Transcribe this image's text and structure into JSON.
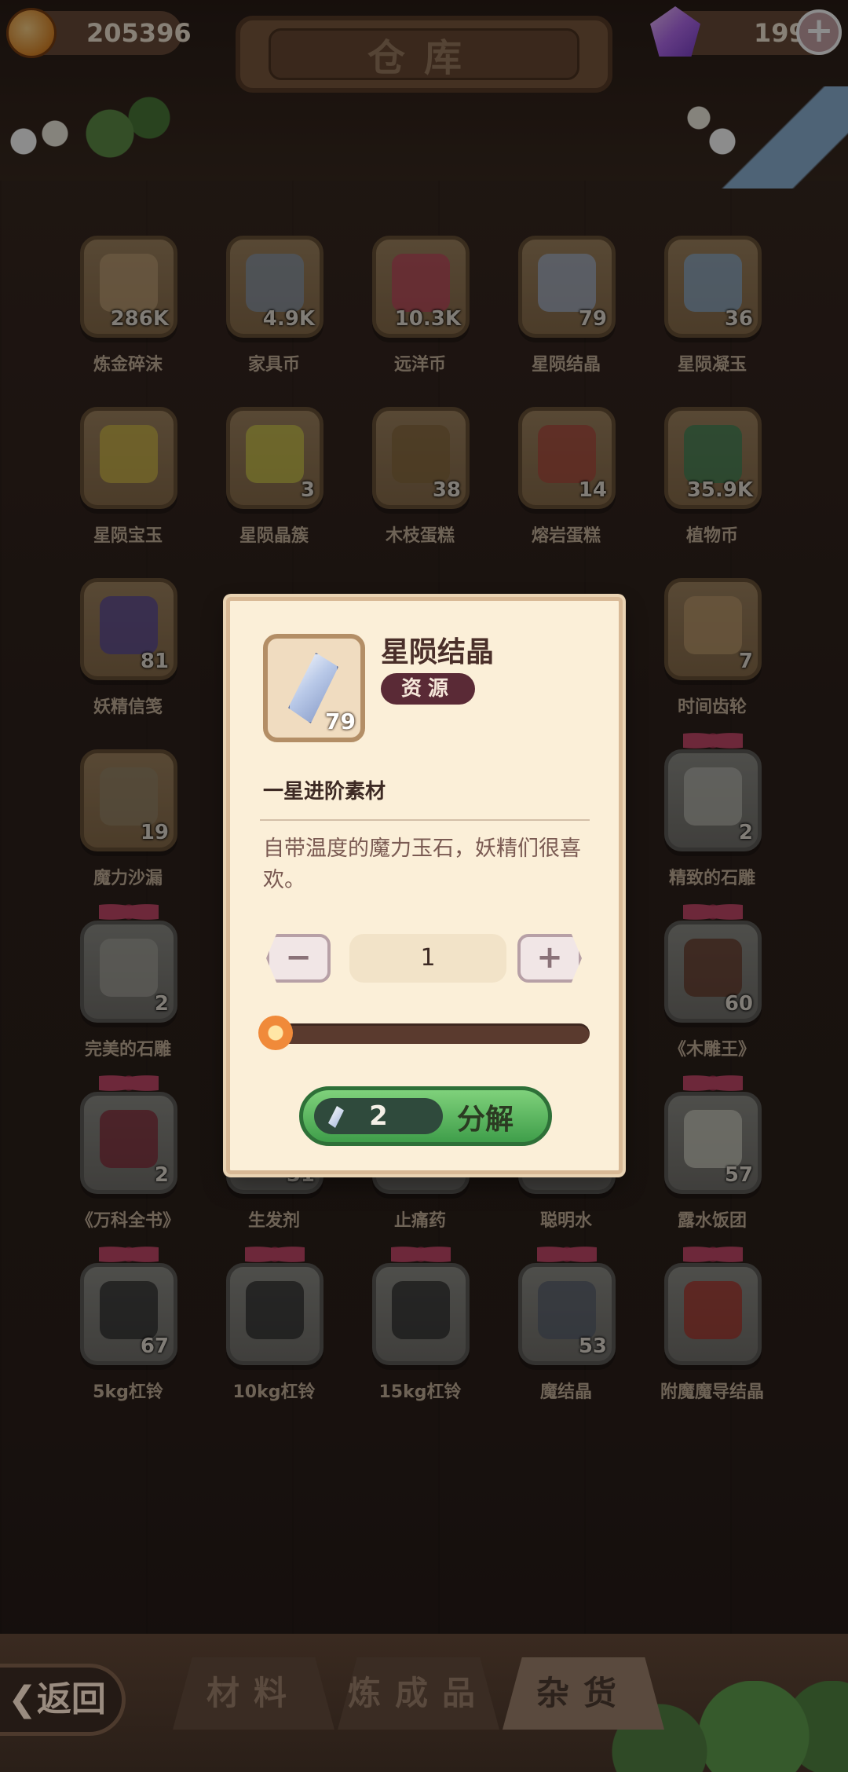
{
  "header": {
    "title": "仓库",
    "gold_amount": "205396",
    "gem_amount": "199"
  },
  "grid_items": [
    {
      "name": "炼金碎沫",
      "count": "286K",
      "gift": false,
      "color": "#c4a47a"
    },
    {
      "name": "家具币",
      "count": "4.9K",
      "gift": false,
      "color": "#8c9eb3"
    },
    {
      "name": "远洋币",
      "count": "10.3K",
      "gift": false,
      "color": "#c74860"
    },
    {
      "name": "星陨结晶",
      "count": "79",
      "gift": false,
      "color": "#a9b9d6"
    },
    {
      "name": "星陨凝玉",
      "count": "36",
      "gift": false,
      "color": "#8fb3d6"
    },
    {
      "name": "星陨宝玉",
      "count": "",
      "gift": false,
      "color": "#d8c24a"
    },
    {
      "name": "星陨晶簇",
      "count": "3",
      "gift": false,
      "color": "#d6d04c"
    },
    {
      "name": "木枝蛋糕",
      "count": "38",
      "gift": false,
      "color": "#8a6b3e"
    },
    {
      "name": "熔岩蛋糕",
      "count": "14",
      "gift": false,
      "color": "#b34a3e"
    },
    {
      "name": "植物币",
      "count": "35.9K",
      "gift": false,
      "color": "#3e8a5a"
    },
    {
      "name": "妖精信笺",
      "count": "81",
      "gift": false,
      "color": "#5a4aa0"
    },
    {
      "name": "时间齿轮",
      "count": "7",
      "gift": false,
      "color": "#c4a072"
    },
    {
      "name": "魔力沙漏",
      "count": "19",
      "gift": false,
      "color": "#9a8a6c"
    },
    {
      "name": "精致的石雕",
      "count": "2",
      "gift": true,
      "color": "#bdbdb5"
    },
    {
      "name": "完美的石雕",
      "count": "2",
      "gift": true,
      "color": "#aaa8a0"
    },
    {
      "name": "《木雕王》",
      "count": "60",
      "gift": true,
      "color": "#6a3a28"
    },
    {
      "name": "《万科全书》",
      "count": "2",
      "gift": true,
      "color": "#8a2a3a"
    },
    {
      "name": "生发剂",
      "count": "31",
      "gift": true,
      "color": "#7a8a6a"
    },
    {
      "name": "止痛药",
      "count": "",
      "gift": true,
      "color": "#8a7a6a"
    },
    {
      "name": "聪明水",
      "count": "",
      "gift": true,
      "color": "#6a7a8a"
    },
    {
      "name": "露水饭团",
      "count": "57",
      "gift": true,
      "color": "#d6d6c8"
    },
    {
      "name": "5kg杠铃",
      "count": "67",
      "gift": true,
      "color": "#2e2e2e"
    },
    {
      "name": "10kg杠铃",
      "count": "",
      "gift": true,
      "color": "#2e2e2e"
    },
    {
      "name": "15kg杠铃",
      "count": "",
      "gift": true,
      "color": "#2e2e2e"
    },
    {
      "name": "魔结晶",
      "count": "53",
      "gift": true,
      "color": "#5a6270"
    },
    {
      "name": "附魔魔导结晶",
      "count": "",
      "gift": true,
      "color": "#b3332a"
    }
  ],
  "modal": {
    "item_name": "星陨结晶",
    "item_count": "79",
    "badge": "资源",
    "subtitle": "一星进阶素材",
    "description": "自带温度的魔力玉石，妖精们很喜欢。",
    "quantity": "1",
    "slider_fraction": 0.03,
    "decompose_count": "2",
    "decompose_label": "分解",
    "minus_symbol": "−",
    "plus_symbol": "+"
  },
  "bottom": {
    "back_label": "❮返回",
    "tabs": [
      "材料",
      "炼成品",
      "杂货"
    ],
    "active_tab": 2
  }
}
